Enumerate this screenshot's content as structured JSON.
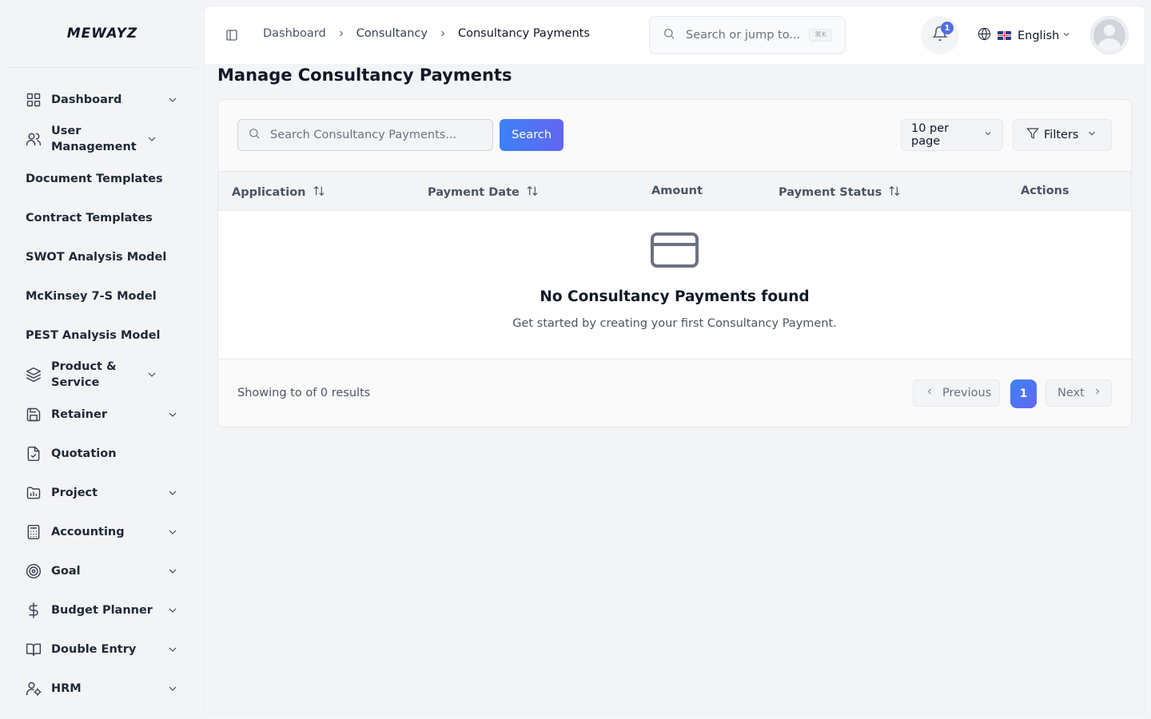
{
  "brand": {
    "logo_text": "MEWAYZ"
  },
  "sidebar": {
    "items": [
      {
        "label": "Dashboard",
        "icon": "grid-icon",
        "has_submenu": true
      },
      {
        "label": "User Management",
        "icon": "users-icon",
        "has_submenu": true
      },
      {
        "label": "Document Templates",
        "icon": "",
        "has_submenu": false
      },
      {
        "label": "Contract Templates",
        "icon": "",
        "has_submenu": false
      },
      {
        "label": "SWOT Analysis Model",
        "icon": "",
        "has_submenu": false
      },
      {
        "label": "McKinsey 7-S Model",
        "icon": "",
        "has_submenu": false
      },
      {
        "label": "PEST Analysis Model",
        "icon": "",
        "has_submenu": false
      },
      {
        "label": "Product & Service",
        "icon": "layers-icon",
        "has_submenu": true
      },
      {
        "label": "Retainer",
        "icon": "save-icon",
        "has_submenu": true
      },
      {
        "label": "Quotation",
        "icon": "file-check-icon",
        "has_submenu": false
      },
      {
        "label": "Project",
        "icon": "folder-chart-icon",
        "has_submenu": true
      },
      {
        "label": "Accounting",
        "icon": "calculator-icon",
        "has_submenu": true
      },
      {
        "label": "Goal",
        "icon": "target-icon",
        "has_submenu": true
      },
      {
        "label": "Budget Planner",
        "icon": "dollar-icon",
        "has_submenu": true
      },
      {
        "label": "Double Entry",
        "icon": "book-icon",
        "has_submenu": true
      },
      {
        "label": "HRM",
        "icon": "user-cog-icon",
        "has_submenu": true
      }
    ]
  },
  "header": {
    "breadcrumbs": [
      "Dashboard",
      "Consultancy",
      "Consultancy Payments"
    ],
    "search_placeholder": "Search or jump to...",
    "search_shortcut": "⌘K",
    "notification_count": "1",
    "language": "English"
  },
  "page": {
    "title": "Manage Consultancy Payments",
    "search_placeholder": "Search Consultancy Payments...",
    "search_button": "Search",
    "per_page": "10 per page",
    "filters_label": "Filters",
    "table": {
      "columns": [
        "Application",
        "Payment Date",
        "Amount",
        "Payment Status",
        "Actions"
      ],
      "rows": []
    },
    "empty": {
      "title": "No Consultancy Payments found",
      "subtitle": "Get started by creating your first Consultancy Payment."
    },
    "footer": {
      "showing": "Showing to of 0 results",
      "previous": "Previous",
      "current_page": "1",
      "next": "Next"
    }
  },
  "colors": {
    "accent": "#4f6ee8",
    "gradient_start": "#3b82f6",
    "gradient_end": "#6366f1"
  }
}
